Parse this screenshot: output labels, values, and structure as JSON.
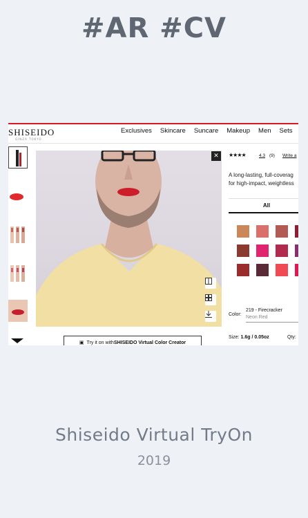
{
  "hashtags": "#AR #CV",
  "project": {
    "title": "Shiseido Virtual TryOn",
    "year": "2019"
  },
  "site": {
    "brand": "SHISEIDO",
    "brand_sub": "GINZA TOKYO",
    "nav": [
      "Exclusives",
      "Skincare",
      "Suncare",
      "Makeup",
      "Men",
      "Sets"
    ]
  },
  "product": {
    "stars": "★★★★",
    "rating": "4.3",
    "review_count": "(9)",
    "write_review": "Write a",
    "description_lines": [
      "A long-lasting, full-coverag",
      "for high-impact, weightless"
    ],
    "tab_all": "All",
    "color_label": "Color:",
    "color_name": "219 - Firecracker",
    "color_subname": "Neon Red",
    "size_label": "Size:",
    "size_value": "1.6g / 0.05oz",
    "qty_label": "Qty:"
  },
  "swatches": [
    "#c9875a",
    "#d9716a",
    "#b45a55",
    "#8e1d32",
    "#8a3a2e",
    "#e0246f",
    "#b22b4f",
    "#8a2d6e",
    "#9a2c2c",
    "#5a2a36",
    "#f04a55",
    "#e01750"
  ],
  "camera": {
    "close_icon": "close-icon",
    "buttons": [
      "compare-icon",
      "grid-icon",
      "download-icon"
    ]
  },
  "tryon_cta": {
    "prefix": "Try it on with ",
    "brand": "SHISEIDO Virtual Color Creator"
  }
}
